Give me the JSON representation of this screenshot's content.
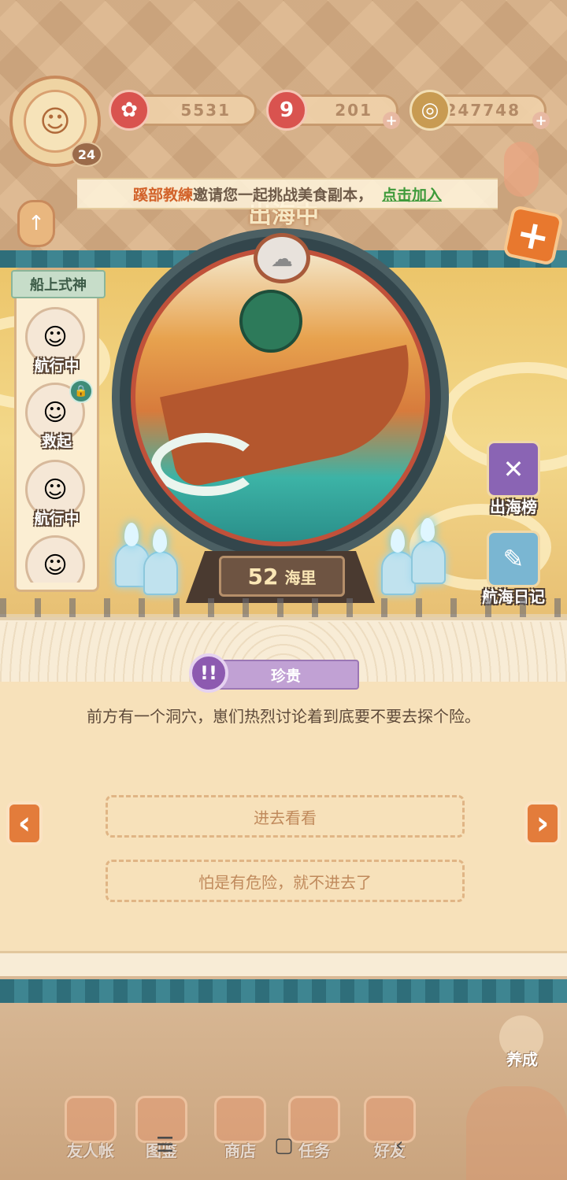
{
  "player": {
    "level": "24"
  },
  "resources": [
    {
      "name": "jade",
      "value": "5531",
      "color": "#d9534f"
    },
    {
      "name": "stamina",
      "value": "201",
      "color": "#d9534f"
    },
    {
      "name": "coins",
      "value": "247748",
      "color": "#c89b52"
    }
  ],
  "invite": {
    "name": "蹊部教練",
    "message": "邀请您一起挑战美食副本，",
    "action": "点击加入"
  },
  "voyage": {
    "status_title": "出海中",
    "distance_value": "52",
    "distance_unit": "海里"
  },
  "crew": {
    "title": "船上式神",
    "members": [
      {
        "status": "航行中",
        "icon": "shikigami-blonde-icon"
      },
      {
        "status": "救起",
        "icon": "shikigami-brunette-icon",
        "locked": true
      },
      {
        "status": "航行中",
        "icon": "shikigami-silver-icon"
      },
      {
        "status": "",
        "icon": "shikigami-dark-icon"
      }
    ]
  },
  "side_buttons": {
    "leaderboard": "出海榜",
    "diary": "航海日记"
  },
  "event": {
    "rarity": "珍贵",
    "description": "前方有一个洞穴，崽们热烈讨论着到底要不要去探个险。",
    "choices": [
      "进去看看",
      "怕是有危险，就不进去了"
    ]
  },
  "bottom_nav": {
    "grow": "养成",
    "items": [
      "友人帐",
      "图鉴",
      "商店",
      "任务",
      "好友"
    ]
  },
  "system_nav": {
    "menu": "☰",
    "home": "▢",
    "back": "‹"
  }
}
